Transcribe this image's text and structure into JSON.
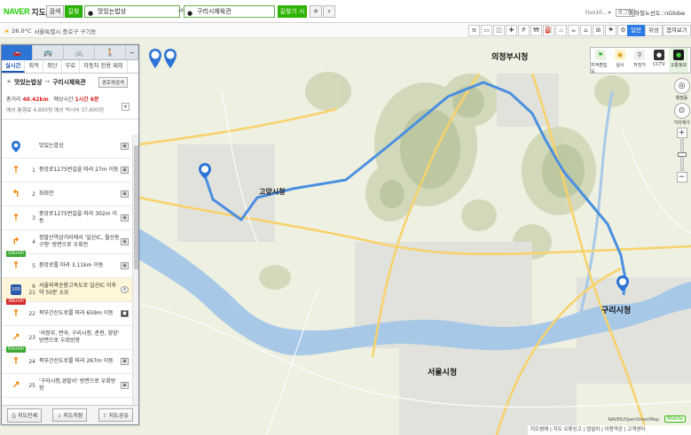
{
  "header": {
    "logo_naver": "NAVER",
    "logo_jido": "지도",
    "search_mode": "검색",
    "route_mode": "길찾기",
    "from_value": "맛있는밥상",
    "to_value": "구리시체육관",
    "start_route": "길찾기 시작",
    "user_id": "tivo10...",
    "login": "로그인",
    "links": [
      "지하철노선도",
      "nGlobe"
    ]
  },
  "subbar": {
    "temperature": "26.0°C",
    "location": "서울특별시 중로구 구기동",
    "map_types": [
      "일반",
      "위성",
      "겹쳐보기"
    ],
    "active_map_type": "일반"
  },
  "tools": [
    {
      "label": "지적편집도",
      "icon": "flag-icon"
    },
    {
      "label": "실시",
      "icon": "realtime-icon"
    },
    {
      "label": "자전거",
      "icon": "bike-icon"
    },
    {
      "label": "CCTV",
      "icon": "cctv-icon"
    },
    {
      "label": "교통정보",
      "icon": "traffic-light-icon"
    }
  ],
  "zoom_panel": {
    "labels": [
      "행정동",
      "거리재기"
    ]
  },
  "panel": {
    "tabs": [
      "실시간",
      "최적",
      "최단",
      "무료",
      "자동차 전용 제외"
    ],
    "summary": {
      "from": "맛있는밥상",
      "to": "구리시체육관",
      "recheck": "경로재검색",
      "total_distance_label": "총거리",
      "total_distance": "48.42km",
      "time_label": "예상시간",
      "time": "1시간 6분",
      "fee": "예상 통행료 4,800원 예상 택시비 37,600원"
    },
    "steps": [
      {
        "num": "",
        "icon": "start-pin-icon",
        "text": "맛있는밥상",
        "badge": ""
      },
      {
        "num": "1",
        "icon": "straight-arrow-icon",
        "text": "중앙로1275번길을 따라 27m 이동",
        "badge": ""
      },
      {
        "num": "2",
        "icon": "left-turn-icon",
        "text": "좌회전",
        "badge": ""
      },
      {
        "num": "3",
        "icon": "straight-arrow-icon",
        "text": "중앙로1275번길을 따라 302m 이동",
        "badge": ""
      },
      {
        "num": "4",
        "icon": "right-turn-icon",
        "text": "정발산역삼거리에서 '일산IC, 월산동구청' 방면으로 우회전",
        "badge": ""
      },
      {
        "num": "5",
        "icon": "straight-arrow-icon",
        "text": "중앙로를 따라 3.11km 이동",
        "badge": "10km/h"
      },
      {
        "num": "6\n21",
        "icon": "highway-icon",
        "text": "서울외곽순환고속도로 일산IC 이후 약 50분 소요",
        "badge": ""
      },
      {
        "num": "22",
        "icon": "straight-arrow-icon",
        "text": "북부간선도로를 따라 659m 이동",
        "badge": "38km/h"
      },
      {
        "num": "23",
        "icon": "right-curve-icon",
        "text": "'의정부, 면곡, 구리시청, 춘천, 양양' 방면으로 우회방향",
        "badge": ""
      },
      {
        "num": "24",
        "icon": "straight-arrow-icon",
        "text": "북부간선도로를 따라 267m 이동",
        "badge": "61km/h"
      },
      {
        "num": "25",
        "icon": "right-curve-icon",
        "text": "'구리시청,경찰서' 방면으로 우회방향",
        "badge": ""
      }
    ],
    "footer": [
      "지도인쇄",
      "지도저장",
      "지도공유"
    ]
  },
  "map": {
    "labels": {
      "goyang": "고양시청",
      "uijeongbu": "의정부시청",
      "guri": "구리시청",
      "seoul": "서울시청",
      "start_marker": "출발",
      "end_marker": "도착"
    },
    "attribution": "NAVER/OpenStreetMap",
    "mobile": "Mobile",
    "bottom_bar": "지도범례 | 지도 오류신고 | 앱설치 | 이용약관 | 고객센터"
  },
  "colors": {
    "brand_green": "#1ec800",
    "route_blue": "#2c74d6",
    "route_line": "#4a8fe0"
  }
}
